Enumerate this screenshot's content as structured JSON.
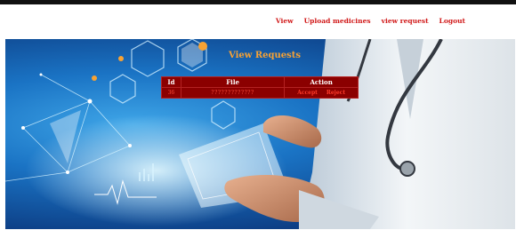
{
  "nav": {
    "items": [
      {
        "label": "View"
      },
      {
        "label": "Upload medicines"
      },
      {
        "label": "view request"
      },
      {
        "label": "Logout"
      }
    ]
  },
  "panel": {
    "title": "View Requests",
    "columns": [
      "Id",
      "File",
      "Action"
    ],
    "rows": [
      {
        "id": "36",
        "file": "?????????????",
        "accept": "Accept",
        "reject": "Reject"
      }
    ]
  },
  "colors": {
    "nav_link": "#d11a1a",
    "title": "#f7a234",
    "table_bg": "#8b0000"
  }
}
